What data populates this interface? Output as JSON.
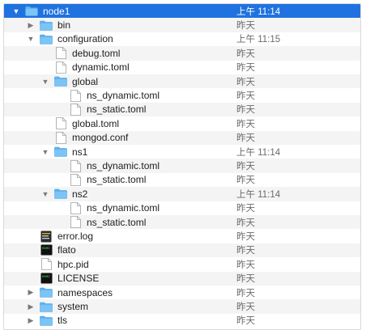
{
  "rows": [
    {
      "name": "node1",
      "date": "上午 11:14",
      "level": 0,
      "kind": "folder",
      "disclosure": "open",
      "selected": true
    },
    {
      "name": "bin",
      "date": "昨天",
      "level": 1,
      "kind": "folder",
      "disclosure": "closed"
    },
    {
      "name": "configuration",
      "date": "上午 11:15",
      "level": 1,
      "kind": "folder",
      "disclosure": "open"
    },
    {
      "name": "debug.toml",
      "date": "昨天",
      "level": 2,
      "kind": "file"
    },
    {
      "name": "dynamic.toml",
      "date": "昨天",
      "level": 2,
      "kind": "file"
    },
    {
      "name": "global",
      "date": "昨天",
      "level": 2,
      "kind": "folder",
      "disclosure": "open"
    },
    {
      "name": "ns_dynamic.toml",
      "date": "昨天",
      "level": 3,
      "kind": "file"
    },
    {
      "name": "ns_static.toml",
      "date": "昨天",
      "level": 3,
      "kind": "file"
    },
    {
      "name": "global.toml",
      "date": "昨天",
      "level": 2,
      "kind": "file"
    },
    {
      "name": "mongod.conf",
      "date": "昨天",
      "level": 2,
      "kind": "file"
    },
    {
      "name": "ns1",
      "date": "上午 11:14",
      "level": 2,
      "kind": "folder",
      "disclosure": "open"
    },
    {
      "name": "ns_dynamic.toml",
      "date": "昨天",
      "level": 3,
      "kind": "file"
    },
    {
      "name": "ns_static.toml",
      "date": "昨天",
      "level": 3,
      "kind": "file"
    },
    {
      "name": "ns2",
      "date": "上午 11:14",
      "level": 2,
      "kind": "folder",
      "disclosure": "open"
    },
    {
      "name": "ns_dynamic.toml",
      "date": "昨天",
      "level": 3,
      "kind": "file"
    },
    {
      "name": "ns_static.toml",
      "date": "昨天",
      "level": 3,
      "kind": "file"
    },
    {
      "name": "error.log",
      "date": "昨天",
      "level": 1,
      "kind": "log"
    },
    {
      "name": "flato",
      "date": "昨天",
      "level": 1,
      "kind": "exec"
    },
    {
      "name": "hpc.pid",
      "date": "昨天",
      "level": 1,
      "kind": "file"
    },
    {
      "name": "LICENSE",
      "date": "昨天",
      "level": 1,
      "kind": "exec"
    },
    {
      "name": "namespaces",
      "date": "昨天",
      "level": 1,
      "kind": "folder",
      "disclosure": "closed"
    },
    {
      "name": "system",
      "date": "昨天",
      "level": 1,
      "kind": "folder",
      "disclosure": "closed"
    },
    {
      "name": "tls",
      "date": "昨天",
      "level": 1,
      "kind": "folder",
      "disclosure": "closed"
    }
  ],
  "colors": {
    "folder": "#5fb4f1",
    "selection": "#1f72df"
  },
  "icons": {
    "open": "disclosure-open-icon",
    "closed": "disclosure-closed-icon"
  }
}
